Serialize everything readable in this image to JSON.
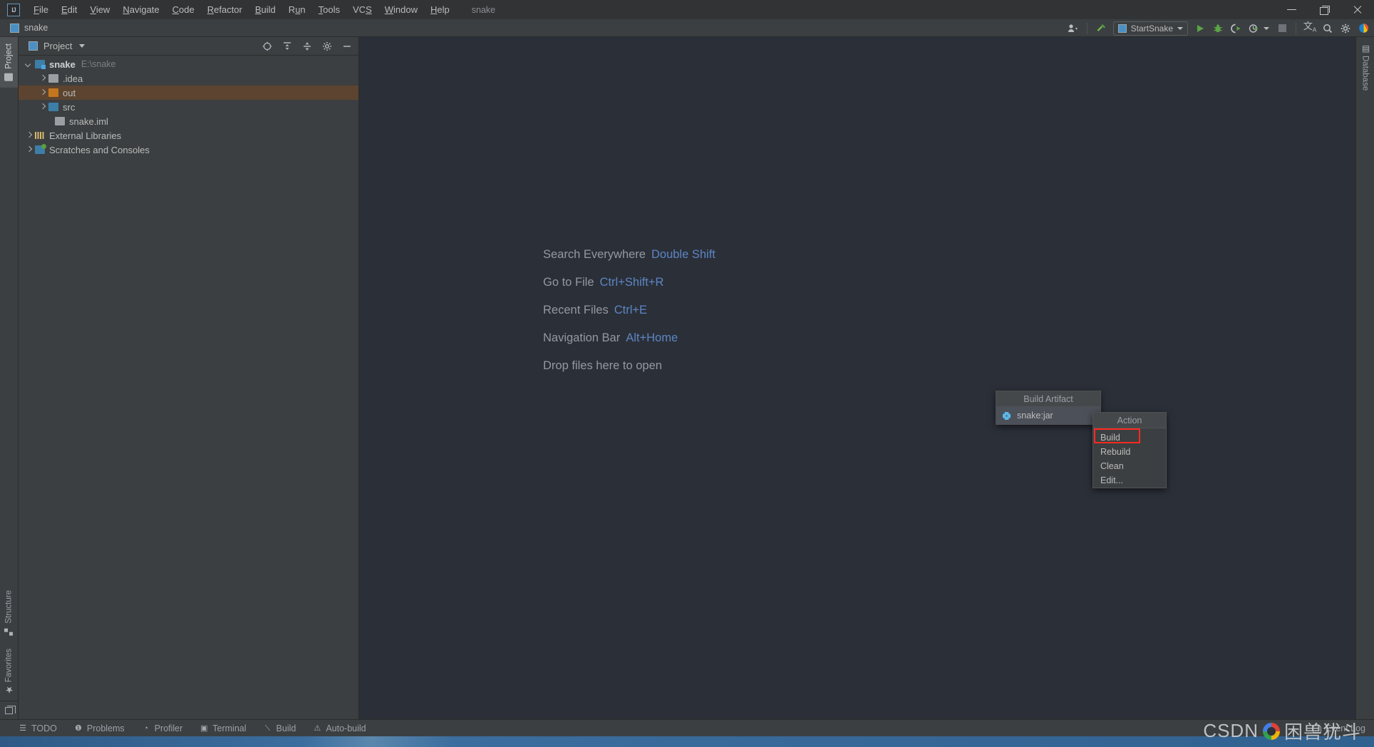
{
  "window": {
    "app_title": "snake",
    "logo": "intellij-idea-logo",
    "controls": {
      "minimize": "minimize-icon",
      "maximize": "maximize-icon",
      "close": "close-icon"
    }
  },
  "menubar": {
    "items": [
      {
        "label": "File",
        "mnemonic": "F"
      },
      {
        "label": "Edit",
        "mnemonic": "E"
      },
      {
        "label": "View",
        "mnemonic": "V"
      },
      {
        "label": "Navigate",
        "mnemonic": "N"
      },
      {
        "label": "Code",
        "mnemonic": "C"
      },
      {
        "label": "Refactor",
        "mnemonic": "R"
      },
      {
        "label": "Build",
        "mnemonic": "B"
      },
      {
        "label": "Run",
        "mnemonic": "u"
      },
      {
        "label": "Tools",
        "mnemonic": "T"
      },
      {
        "label": "VCS",
        "mnemonic": "S"
      },
      {
        "label": "Window",
        "mnemonic": "W"
      },
      {
        "label": "Help",
        "mnemonic": "H"
      }
    ]
  },
  "toolbar": {
    "breadcrumb": "snake",
    "run_config": "StartSnake",
    "icons": [
      "user-avatar-icon",
      "build-hammer-icon",
      "run-icon",
      "debug-icon",
      "run-coverage-icon",
      "profile-icon",
      "stop-icon",
      "translate-icon",
      "search-everywhere-icon",
      "settings-gear-icon",
      "ide-assistant-icon"
    ]
  },
  "left_stripe": {
    "top_tabs": [
      {
        "label": "Project",
        "icon": "project-folder-icon",
        "selected": true
      }
    ],
    "bottom_tabs": [
      {
        "label": "Structure",
        "icon": "structure-icon",
        "selected": false
      },
      {
        "label": "Favorites",
        "icon": "star-icon",
        "selected": false
      }
    ],
    "restore_button": "restore-layout-icon"
  },
  "right_stripe": {
    "tabs": [
      {
        "label": "Database",
        "icon": "database-icon",
        "selected": false
      }
    ]
  },
  "project_panel": {
    "title": "Project",
    "tools": [
      "select-opened-file-icon",
      "expand-all-icon",
      "collapse-all-icon",
      "settings-gear-icon",
      "hide-icon"
    ],
    "tree": [
      {
        "label": "snake",
        "path": "E:\\snake",
        "indent": 0,
        "arrow": "down",
        "icon": "module-folder-icon",
        "bold": true,
        "selected": false
      },
      {
        "label": ".idea",
        "path": "",
        "indent": 1,
        "arrow": "right",
        "icon": "folder-icon-gray",
        "bold": false,
        "selected": false
      },
      {
        "label": "out",
        "path": "",
        "indent": 1,
        "arrow": "right",
        "icon": "folder-icon-orange",
        "bold": false,
        "selected": true
      },
      {
        "label": "src",
        "path": "",
        "indent": 1,
        "arrow": "right",
        "icon": "folder-icon-blue",
        "bold": false,
        "selected": false
      },
      {
        "label": "snake.iml",
        "path": "",
        "indent": 2,
        "arrow": "none",
        "icon": "iml-file-icon",
        "bold": false,
        "selected": false
      },
      {
        "label": "External Libraries",
        "path": "",
        "indent": 0,
        "arrow": "right",
        "icon": "libraries-icon",
        "bold": false,
        "selected": false
      },
      {
        "label": "Scratches and Consoles",
        "path": "",
        "indent": 0,
        "arrow": "right",
        "icon": "scratches-icon",
        "bold": false,
        "selected": false
      }
    ]
  },
  "editor_hints": [
    {
      "label": "Search Everywhere",
      "shortcut": "Double Shift"
    },
    {
      "label": "Go to File",
      "shortcut": "Ctrl+Shift+R"
    },
    {
      "label": "Recent Files",
      "shortcut": "Ctrl+E"
    },
    {
      "label": "Navigation Bar",
      "shortcut": "Alt+Home"
    },
    {
      "label": "Drop files here to open",
      "shortcut": ""
    }
  ],
  "popup_build_artifact": {
    "title": "Build Artifact",
    "items": [
      {
        "label": "snake:jar",
        "icon": "jar-artifact-icon",
        "has_submenu": true,
        "submenu_arrow": "›",
        "highlighted": true
      }
    ]
  },
  "popup_action": {
    "title": "Action",
    "items": [
      {
        "label": "Build",
        "annotated": true
      },
      {
        "label": "Rebuild",
        "annotated": false
      },
      {
        "label": "Clean",
        "annotated": false
      },
      {
        "label": "Edit...",
        "annotated": false
      }
    ],
    "annotation_color": "#ff2a1e"
  },
  "bottom_bar": {
    "tabs": [
      {
        "label": "TODO",
        "icon": "todo-list-icon"
      },
      {
        "label": "Problems",
        "icon": "problems-icon"
      },
      {
        "label": "Profiler",
        "icon": "profiler-icon"
      },
      {
        "label": "Terminal",
        "icon": "terminal-icon"
      },
      {
        "label": "Build",
        "icon": "build-hammer-icon"
      },
      {
        "label": "Auto-build",
        "icon": "warning-triangle-icon"
      }
    ],
    "event_log": {
      "label": "Event Log",
      "icon": "event-log-icon"
    }
  },
  "watermark": {
    "text_left": "CSDN",
    "logo": "google-chrome-icon",
    "text_right": "困兽犹斗"
  },
  "colors": {
    "accent_blue": "#5c86c3",
    "selection_orange": "#5c4430",
    "annotation_red": "#ff2a1e",
    "panel_bg": "#3c3f41",
    "editor_bg": "#2b2f38"
  }
}
